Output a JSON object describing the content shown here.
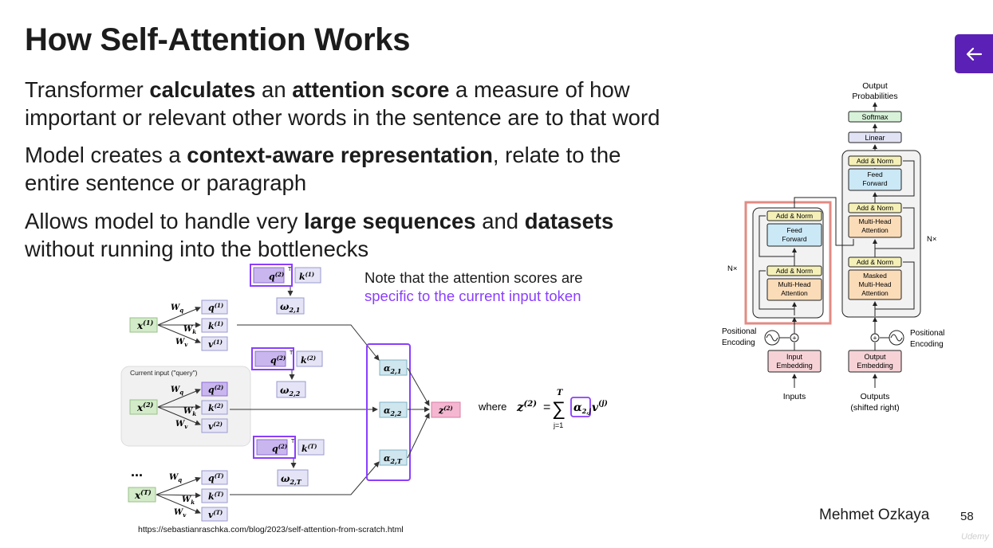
{
  "slide": {
    "title": "How Self-Attention Works",
    "bullets": [
      {
        "parts": [
          {
            "text": "Transformer ",
            "bold": false
          },
          {
            "text": "calculates",
            "bold": true
          },
          {
            "text": " an ",
            "bold": false
          },
          {
            "text": "attention score",
            "bold": true
          },
          {
            "text": " a measure of how important or relevant other words in the sentence are to that word",
            "bold": false
          }
        ]
      },
      {
        "parts": [
          {
            "text": "Model creates a ",
            "bold": false
          },
          {
            "text": "context-aware representation",
            "bold": true
          },
          {
            "text": ", relate to the entire sentence or paragraph",
            "bold": false
          }
        ]
      },
      {
        "parts": [
          {
            "text": "Allows model to handle very ",
            "bold": false
          },
          {
            "text": "large sequences",
            "bold": true
          },
          {
            "text": " and ",
            "bold": false
          },
          {
            "text": "datasets",
            "bold": true
          },
          {
            "text": " without running into the bottlenecks",
            "bold": false
          }
        ]
      }
    ],
    "author": "Mehmet Ozkaya",
    "page_number": "58",
    "watermark": "Udemy",
    "back_icon": "arrow-left-icon",
    "accent_color": "#5b21b6"
  },
  "attention_diagram": {
    "note_line1": "Note that the attention scores are",
    "note_line2": "specific to the current input token",
    "current_input_label": "Current input (\"query\")",
    "source_url": "https://sebastianraschka.com/blog/2023/self-attention-from-scratch.html",
    "ellipsis": "...",
    "weights": {
      "wq": "W",
      "wq_sub": "q",
      "wk": "W",
      "wk_sub": "k",
      "wv": "W",
      "wv_sub": "v"
    },
    "inputs": [
      {
        "x": "x",
        "sup": "(1)"
      },
      {
        "x": "x",
        "sup": "(2)"
      },
      {
        "x": "x",
        "sup": "(T)"
      }
    ],
    "qkv": [
      {
        "q": "q",
        "k": "k",
        "v": "v",
        "sup": "(1)"
      },
      {
        "q": "q",
        "k": "k",
        "v": "v",
        "sup": "(2)"
      },
      {
        "q": "q",
        "k": "k",
        "v": "v",
        "sup": "(T)"
      }
    ],
    "dot_pairs": [
      {
        "q": "q",
        "q_sup": "(2)",
        "k": "k",
        "k_sup": "(1)",
        "omega": "ω",
        "omega_sub": "2,1",
        "alpha": "α",
        "alpha_sub": "2,1"
      },
      {
        "q": "q",
        "q_sup": "(2)",
        "k": "k",
        "k_sup": "(2)",
        "omega": "ω",
        "omega_sub": "2,2",
        "alpha": "α",
        "alpha_sub": "2,2"
      },
      {
        "q": "q",
        "q_sup": "(2)",
        "k": "k",
        "k_sup": "(T)",
        "omega": "ω",
        "omega_sub": "2,T",
        "alpha": "α",
        "alpha_sub": "2,T"
      }
    ],
    "output": {
      "z": "z",
      "sup": "(2)"
    },
    "transpose_mark": "T",
    "formula": {
      "where": "where",
      "lhs": "z",
      "lhs_sup": "(2)",
      "eq": "=",
      "sum": "∑",
      "upper": "T",
      "lower": "j=1",
      "alpha": "α",
      "alpha_sub": "2,j",
      "v": "v",
      "v_sup": "(j)"
    }
  },
  "transformer_diagram": {
    "output_probabilities": [
      "Output",
      "Probabilities"
    ],
    "softmax": "Softmax",
    "linear": "Linear",
    "add_norm": "Add & Norm",
    "feed_forward": [
      "Feed",
      "Forward"
    ],
    "multi_head": [
      "Multi-Head",
      "Attention"
    ],
    "masked_multi_head": [
      "Masked",
      "Multi-Head",
      "Attention"
    ],
    "nx": "N×",
    "positional_encoding": [
      "Positional",
      "Encoding"
    ],
    "plus": "+",
    "input_embedding": [
      "Input",
      "Embedding"
    ],
    "output_embedding": [
      "Output",
      "Embedding"
    ],
    "inputs": "Inputs",
    "outputs": [
      "Outputs",
      "(shifted right)"
    ]
  }
}
